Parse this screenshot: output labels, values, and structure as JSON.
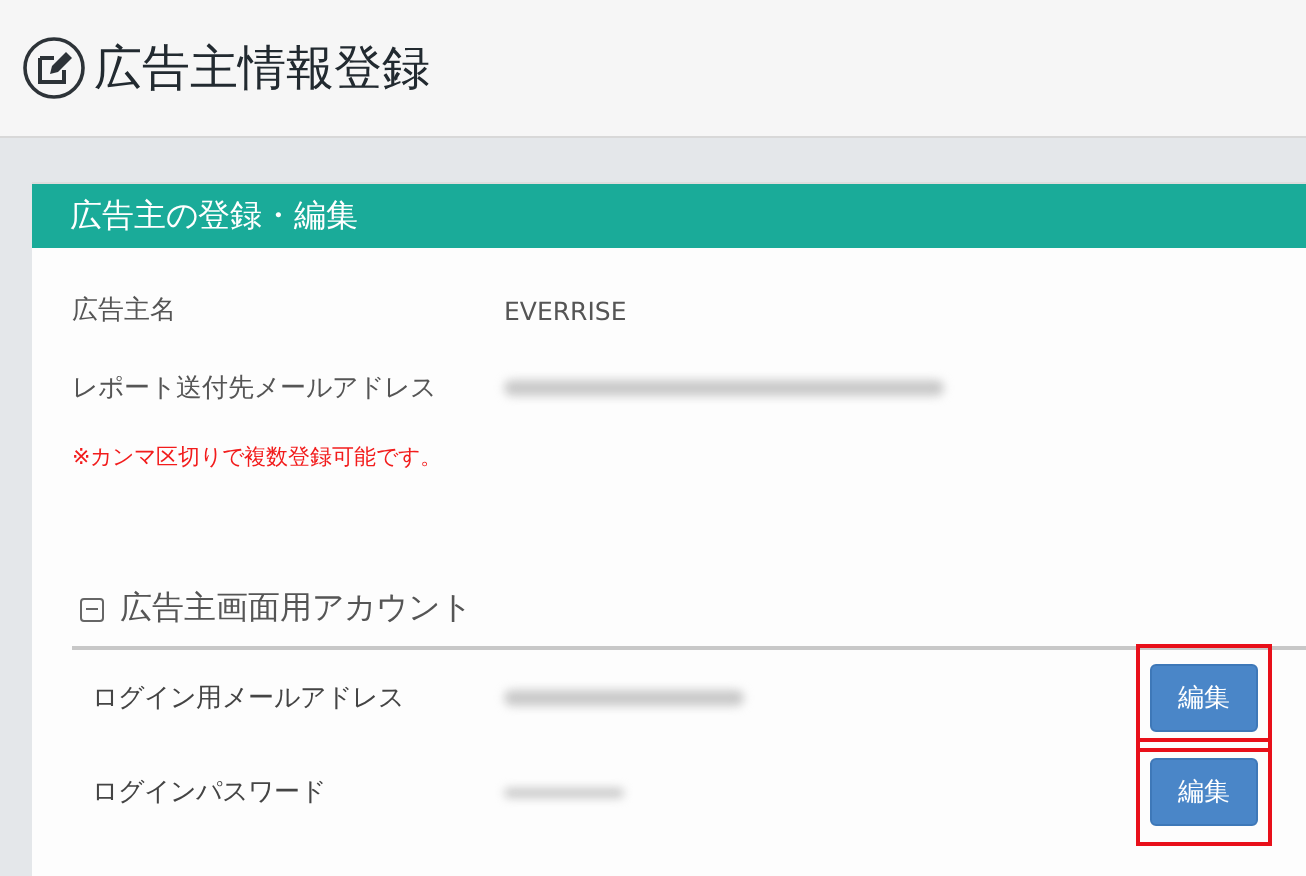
{
  "page": {
    "title": "広告主情報登録"
  },
  "card": {
    "title": "広告主の登録・編集",
    "fields": [
      {
        "label": "広告主名",
        "kind": "text",
        "value": "EVERRISE"
      },
      {
        "label": "レポート送付先メールアドレス",
        "kind": "redacted"
      }
    ],
    "note": "※カンマ区切りで複数登録可能です。",
    "section": {
      "title": "広告主画面用アカウント",
      "expanded": true,
      "rows": [
        {
          "label": "ログイン用メールアドレス",
          "kind": "redacted",
          "button": "編集",
          "highlighted": true
        },
        {
          "label": "ログインパスワード",
          "kind": "redacted-short",
          "button": "編集",
          "highlighted": true
        }
      ]
    }
  }
}
